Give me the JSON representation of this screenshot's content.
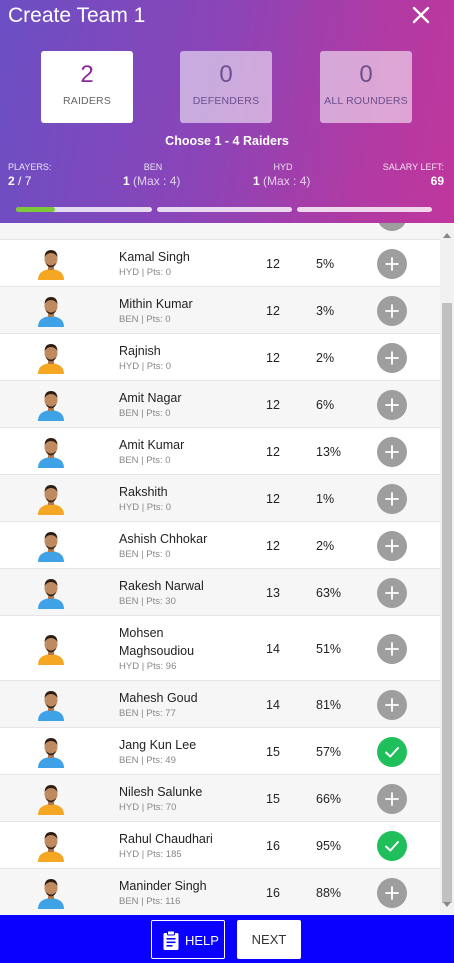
{
  "header": {
    "title": "Create Team 1",
    "close_icon": "close-icon"
  },
  "roles": {
    "raiders": {
      "count": "2",
      "label": "RAIDERS"
    },
    "defenders": {
      "count": "0",
      "label": "DEFENDERS"
    },
    "all_rounders": {
      "count": "0",
      "label": "ALL ROUNDERS"
    }
  },
  "choose_text": "Choose 1 - 4 Raiders",
  "stats": {
    "players_label": "PLAYERS:",
    "players_current": "2",
    "players_total": " / 7",
    "ben_label": "BEN",
    "ben_value": "1",
    "ben_max": " (Max : 4)",
    "hyd_label": "HYD",
    "hyd_value": "1",
    "hyd_max": " (Max : 4)",
    "salary_label": "SALARY LEFT:",
    "salary_value": "69"
  },
  "progress": {
    "filled_fraction_first_bar": 0.29
  },
  "colors": {
    "ben_jersey": "#3fa2e6",
    "hyd_jersey": "#f5a623",
    "add_button": "#9e9e9e",
    "selected_button": "#1fbf5c",
    "footer": "#0a00ff",
    "progress_fill": "#7cc83a"
  },
  "players": [
    {
      "name": "Kamal Singh",
      "meta": "HYD | Pts: 0",
      "credits": "12",
      "selected_by": "5%",
      "team": "HYD",
      "selected": false
    },
    {
      "name": "Mithin Kumar",
      "meta": "BEN | Pts: 0",
      "credits": "12",
      "selected_by": "3%",
      "team": "BEN",
      "selected": false
    },
    {
      "name": "Rajnish",
      "meta": "HYD | Pts: 0",
      "credits": "12",
      "selected_by": "2%",
      "team": "HYD",
      "selected": false
    },
    {
      "name": "Amit Nagar",
      "meta": "BEN | Pts: 0",
      "credits": "12",
      "selected_by": "6%",
      "team": "BEN",
      "selected": false
    },
    {
      "name": "Amit Kumar",
      "meta": "BEN | Pts: 0",
      "credits": "12",
      "selected_by": "13%",
      "team": "BEN",
      "selected": false
    },
    {
      "name": "Rakshith",
      "meta": "HYD | Pts: 0",
      "credits": "12",
      "selected_by": "1%",
      "team": "HYD",
      "selected": false
    },
    {
      "name": "Ashish Chhokar",
      "meta": "BEN | Pts: 0",
      "credits": "12",
      "selected_by": "2%",
      "team": "BEN",
      "selected": false
    },
    {
      "name": "Rakesh Narwal",
      "meta": "BEN | Pts: 30",
      "credits": "13",
      "selected_by": "63%",
      "team": "BEN",
      "selected": false
    },
    {
      "name": "Mohsen Maghsoudiou",
      "meta": "HYD | Pts: 96",
      "credits": "14",
      "selected_by": "51%",
      "team": "HYD",
      "selected": false
    },
    {
      "name": "Mahesh Goud",
      "meta": "BEN | Pts: 77",
      "credits": "14",
      "selected_by": "81%",
      "team": "BEN",
      "selected": false
    },
    {
      "name": "Jang Kun Lee",
      "meta": "BEN | Pts: 49",
      "credits": "15",
      "selected_by": "57%",
      "team": "BEN",
      "selected": true
    },
    {
      "name": "Nilesh Salunke",
      "meta": "HYD | Pts: 70",
      "credits": "15",
      "selected_by": "66%",
      "team": "HYD",
      "selected": false
    },
    {
      "name": "Rahul Chaudhari",
      "meta": "HYD | Pts: 185",
      "credits": "16",
      "selected_by": "95%",
      "team": "HYD",
      "selected": true
    },
    {
      "name": "Maninder Singh",
      "meta": "BEN | Pts: 116",
      "credits": "16",
      "selected_by": "88%",
      "team": "BEN",
      "selected": false
    }
  ],
  "footer": {
    "help_label": "HELP",
    "help_icon": "clipboard-icon",
    "next_label": "NEXT"
  }
}
